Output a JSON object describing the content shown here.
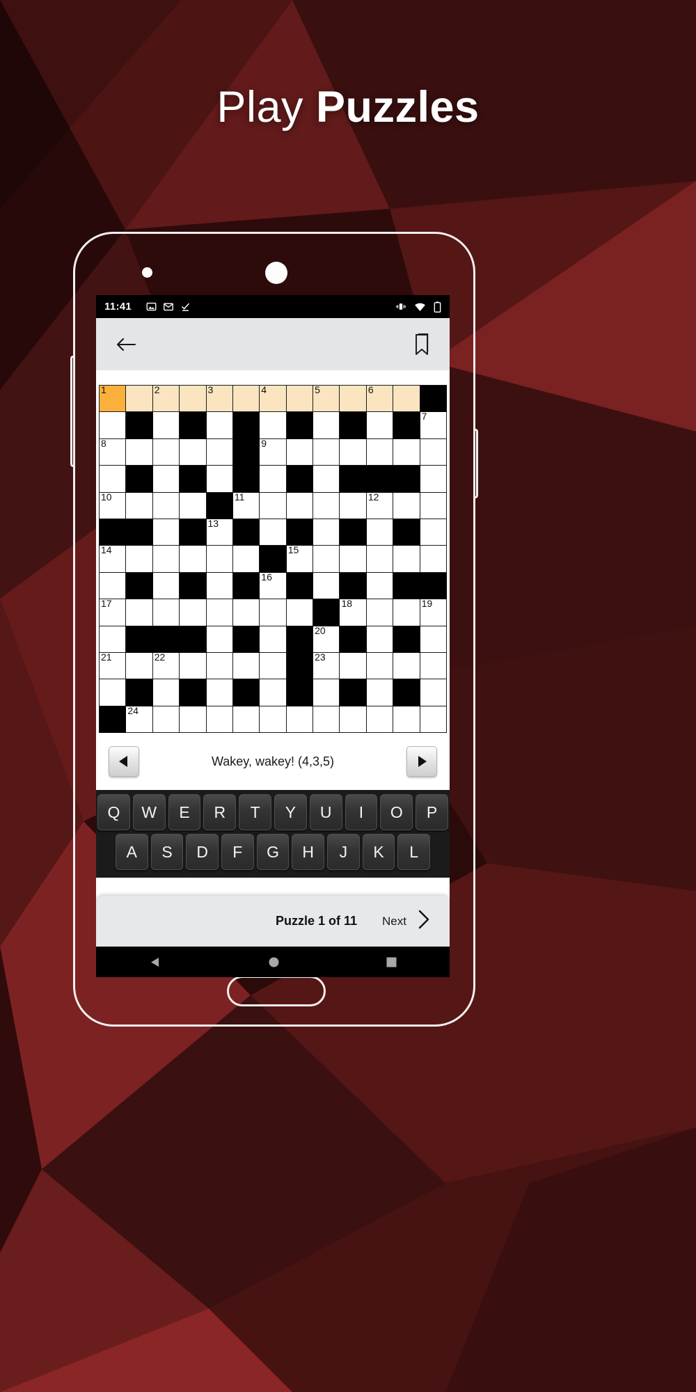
{
  "page": {
    "headline_light": "Play ",
    "headline_bold": "Puzzles",
    "bg_colors": [
      "#2a0a0a",
      "#4a1313",
      "#6b1a1a",
      "#8c2020",
      "#3d0e0e",
      "#1c0606"
    ]
  },
  "statusbar": {
    "time": "11:41",
    "left_icons": [
      "image-icon",
      "gmail-icon",
      "checkmark-icon"
    ],
    "right_icons": [
      "vibrate-icon",
      "wifi-icon",
      "battery-icon"
    ]
  },
  "appbar": {
    "back_icon": "back-arrow-icon",
    "bookmark_icon": "bookmark-icon"
  },
  "clue": {
    "text": "Wakey, wakey! (4,3,5)",
    "prev_icon": "previous-clue-icon",
    "next_icon": "next-clue-icon"
  },
  "keyboard": {
    "row1": [
      "Q",
      "W",
      "E",
      "R",
      "T",
      "Y",
      "U",
      "I",
      "O",
      "P"
    ],
    "row2": [
      "A",
      "S",
      "D",
      "F",
      "G",
      "H",
      "J",
      "K",
      "L"
    ]
  },
  "bottombar": {
    "puzzle_count": "Puzzle 1 of 11",
    "next_label": "Next",
    "chevron_icon": "chevron-right-icon"
  },
  "androidnav": {
    "back": "triangle-back-icon",
    "home": "circle-home-icon",
    "recents": "square-recents-icon"
  },
  "crossword": {
    "cols": 13,
    "rows": 13,
    "accent_current": "#fbb03b",
    "accent_highlight": "#fae5c0",
    "rows_data": [
      {
        "cells": [
          {
            "t": "hl",
            "n": "1",
            "cur": true
          },
          {
            "t": "hl"
          },
          {
            "t": "hl",
            "n": "2"
          },
          {
            "t": "hl"
          },
          {
            "t": "hl",
            "n": "3"
          },
          {
            "t": "hl"
          },
          {
            "t": "hl",
            "n": "4"
          },
          {
            "t": "hl"
          },
          {
            "t": "hl",
            "n": "5"
          },
          {
            "t": "hl"
          },
          {
            "t": "hl",
            "n": "6"
          },
          {
            "t": "hl"
          },
          {
            "t": "b"
          }
        ]
      },
      {
        "cells": [
          {
            "t": "w"
          },
          {
            "t": "b"
          },
          {
            "t": "w"
          },
          {
            "t": "b"
          },
          {
            "t": "w"
          },
          {
            "t": "b"
          },
          {
            "t": "w"
          },
          {
            "t": "b"
          },
          {
            "t": "w"
          },
          {
            "t": "b"
          },
          {
            "t": "w"
          },
          {
            "t": "b"
          },
          {
            "t": "w",
            "n": "7"
          }
        ]
      },
      {
        "cells": [
          {
            "t": "w",
            "n": "8"
          },
          {
            "t": "w"
          },
          {
            "t": "w"
          },
          {
            "t": "w"
          },
          {
            "t": "w"
          },
          {
            "t": "b"
          },
          {
            "t": "w",
            "n": "9"
          },
          {
            "t": "w"
          },
          {
            "t": "w"
          },
          {
            "t": "w"
          },
          {
            "t": "w"
          },
          {
            "t": "w"
          },
          {
            "t": "w"
          }
        ]
      },
      {
        "cells": [
          {
            "t": "w"
          },
          {
            "t": "b"
          },
          {
            "t": "w"
          },
          {
            "t": "b"
          },
          {
            "t": "w"
          },
          {
            "t": "b"
          },
          {
            "t": "w"
          },
          {
            "t": "b"
          },
          {
            "t": "w"
          },
          {
            "t": "b"
          },
          {
            "t": "b"
          },
          {
            "t": "b"
          },
          {
            "t": "w"
          }
        ]
      },
      {
        "cells": [
          {
            "t": "w",
            "n": "10"
          },
          {
            "t": "w"
          },
          {
            "t": "w"
          },
          {
            "t": "w"
          },
          {
            "t": "b"
          },
          {
            "t": "w",
            "n": "11"
          },
          {
            "t": "w"
          },
          {
            "t": "w"
          },
          {
            "t": "w"
          },
          {
            "t": "w"
          },
          {
            "t": "w",
            "n": "12"
          },
          {
            "t": "w"
          },
          {
            "t": "w"
          }
        ]
      },
      {
        "cells": [
          {
            "t": "b"
          },
          {
            "t": "b"
          },
          {
            "t": "w"
          },
          {
            "t": "b"
          },
          {
            "t": "w",
            "n": "13"
          },
          {
            "t": "b"
          },
          {
            "t": "w"
          },
          {
            "t": "b"
          },
          {
            "t": "w"
          },
          {
            "t": "b"
          },
          {
            "t": "w"
          },
          {
            "t": "b"
          },
          {
            "t": "w"
          }
        ]
      },
      {
        "cells": [
          {
            "t": "w",
            "n": "14"
          },
          {
            "t": "w"
          },
          {
            "t": "w"
          },
          {
            "t": "w"
          },
          {
            "t": "w"
          },
          {
            "t": "w"
          },
          {
            "t": "b"
          },
          {
            "t": "w",
            "n": "15"
          },
          {
            "t": "w"
          },
          {
            "t": "w"
          },
          {
            "t": "w"
          },
          {
            "t": "w"
          },
          {
            "t": "w"
          }
        ]
      },
      {
        "cells": [
          {
            "t": "w"
          },
          {
            "t": "b"
          },
          {
            "t": "w"
          },
          {
            "t": "b"
          },
          {
            "t": "w"
          },
          {
            "t": "b"
          },
          {
            "t": "w",
            "n": "16"
          },
          {
            "t": "b"
          },
          {
            "t": "w"
          },
          {
            "t": "b"
          },
          {
            "t": "w"
          },
          {
            "t": "b"
          },
          {
            "t": "b"
          }
        ]
      },
      {
        "cells": [
          {
            "t": "w",
            "n": "17"
          },
          {
            "t": "w"
          },
          {
            "t": "w"
          },
          {
            "t": "w"
          },
          {
            "t": "w"
          },
          {
            "t": "w"
          },
          {
            "t": "w"
          },
          {
            "t": "w"
          },
          {
            "t": "b"
          },
          {
            "t": "w",
            "n": "18"
          },
          {
            "t": "w"
          },
          {
            "t": "w"
          },
          {
            "t": "w",
            "n": "19"
          }
        ]
      },
      {
        "cells": [
          {
            "t": "w"
          },
          {
            "t": "b"
          },
          {
            "t": "b"
          },
          {
            "t": "b"
          },
          {
            "t": "w"
          },
          {
            "t": "b"
          },
          {
            "t": "w"
          },
          {
            "t": "b"
          },
          {
            "t": "w",
            "n": "20"
          },
          {
            "t": "b"
          },
          {
            "t": "w"
          },
          {
            "t": "b"
          },
          {
            "t": "w"
          }
        ]
      },
      {
        "cells": [
          {
            "t": "w",
            "n": "21"
          },
          {
            "t": "w"
          },
          {
            "t": "w",
            "n": "22"
          },
          {
            "t": "w"
          },
          {
            "t": "w"
          },
          {
            "t": "w"
          },
          {
            "t": "w"
          },
          {
            "t": "b"
          },
          {
            "t": "w",
            "n": "23"
          },
          {
            "t": "w"
          },
          {
            "t": "w"
          },
          {
            "t": "w"
          },
          {
            "t": "w"
          }
        ]
      },
      {
        "cells": [
          {
            "t": "w"
          },
          {
            "t": "b"
          },
          {
            "t": "w"
          },
          {
            "t": "b"
          },
          {
            "t": "w"
          },
          {
            "t": "b"
          },
          {
            "t": "w"
          },
          {
            "t": "b"
          },
          {
            "t": "w"
          },
          {
            "t": "b"
          },
          {
            "t": "w"
          },
          {
            "t": "b"
          },
          {
            "t": "w"
          }
        ]
      },
      {
        "cells": [
          {
            "t": "b"
          },
          {
            "t": "w",
            "n": "24"
          },
          {
            "t": "w"
          },
          {
            "t": "w"
          },
          {
            "t": "w"
          },
          {
            "t": "w"
          },
          {
            "t": "w"
          },
          {
            "t": "w"
          },
          {
            "t": "w"
          },
          {
            "t": "w"
          },
          {
            "t": "w"
          },
          {
            "t": "w"
          },
          {
            "t": "w"
          }
        ]
      }
    ]
  }
}
